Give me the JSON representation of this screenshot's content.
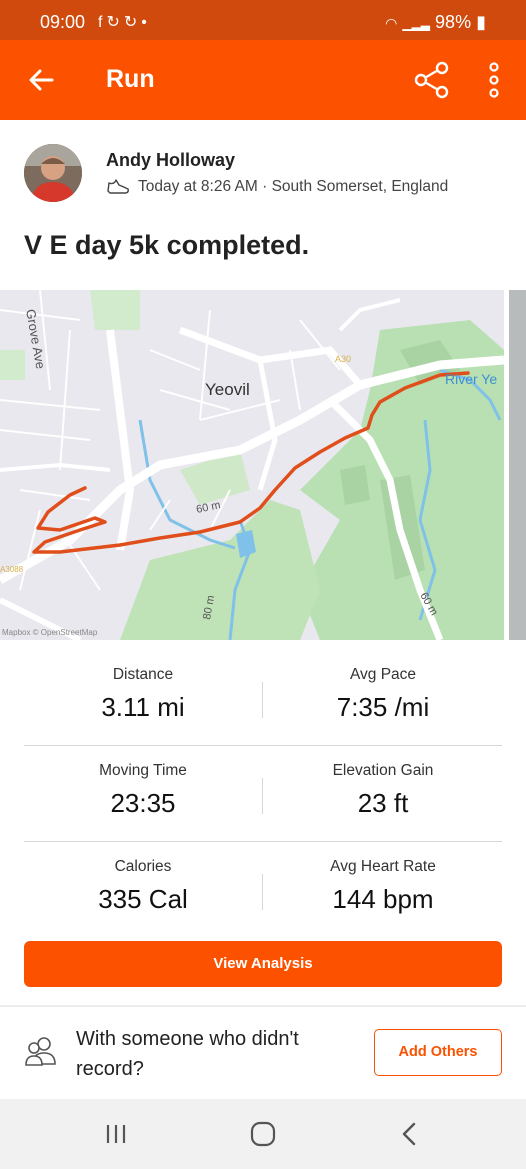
{
  "status_bar": {
    "time": "09:00",
    "notification_icons": [
      "facebook-icon",
      "sync-icon",
      "sync-icon",
      "dot-icon"
    ],
    "battery": "98%"
  },
  "app_bar": {
    "title": "Run",
    "color": "#fc5200"
  },
  "athlete": {
    "name": "Andy Holloway",
    "time": "Today at 8:26 AM",
    "location": "South Somerset, England"
  },
  "activity": {
    "title": "V E day 5k completed."
  },
  "map": {
    "place_labels": [
      "Yeovil",
      "Grove Ave",
      "River Ye"
    ],
    "contour_labels": [
      "60 m",
      "80 m",
      "60 m"
    ],
    "road_labels": [
      "A30",
      "A3088"
    ],
    "attribution": "Mapbox © OpenStreetMap",
    "route_color": "#e04e1b"
  },
  "stats": [
    {
      "label": "Distance",
      "value": "3.11 mi"
    },
    {
      "label": "Avg Pace",
      "value": "7:35 /mi"
    },
    {
      "label": "Moving Time",
      "value": "23:35"
    },
    {
      "label": "Elevation Gain",
      "value": "23 ft"
    },
    {
      "label": "Calories",
      "value": "335 Cal"
    },
    {
      "label": "Avg Heart Rate",
      "value": "144 bpm"
    }
  ],
  "buttons": {
    "view_analysis": "View Analysis",
    "add_others": "Add Others"
  },
  "others_prompt": "With someone who didn't record?",
  "nav_bar": [
    "recent-apps-icon",
    "home-icon",
    "back-icon"
  ]
}
